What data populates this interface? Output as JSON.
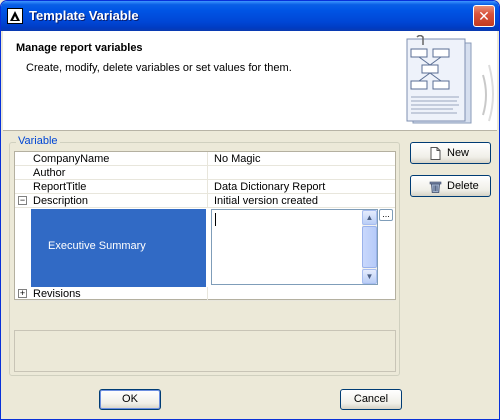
{
  "window": {
    "title": "Template Variable"
  },
  "header": {
    "title": "Manage report variables",
    "description": "Create, modify, delete variables or set values for them."
  },
  "group": {
    "label": "Variable"
  },
  "variables": [
    {
      "name": "CompanyName",
      "value": "No Magic"
    },
    {
      "name": "Author",
      "value": ""
    },
    {
      "name": "ReportTitle",
      "value": "Data Dictionary Report"
    },
    {
      "name": "Description",
      "value": "Initial version created",
      "expanded": true
    },
    {
      "name": "Executive Summary",
      "value": "",
      "selected": true
    },
    {
      "name": "Revisions",
      "value": "",
      "expanded": false
    }
  ],
  "buttons": {
    "new": "New",
    "delete": "Delete",
    "ok": "OK",
    "cancel": "Cancel",
    "ellipsis": "..."
  },
  "icons": {
    "expand": "+",
    "collapse": "−",
    "scroll_up": "▲",
    "scroll_down": "▼",
    "close": "✕"
  },
  "colors": {
    "selection": "#316ac5",
    "titlebar": "#0055e5",
    "group_label": "#0046d5"
  }
}
